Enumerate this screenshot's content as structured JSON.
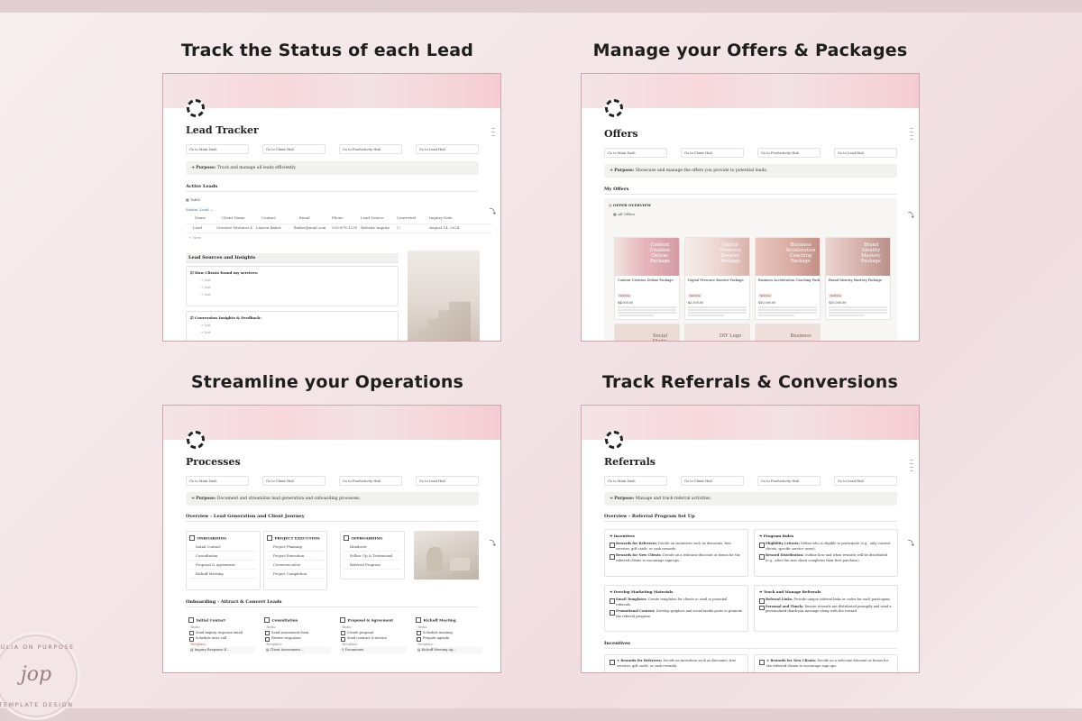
{
  "panels": {
    "p1": {
      "heading": "Track the Status of each Lead"
    },
    "p2": {
      "heading": "Manage your Offers & Packages"
    },
    "p3": {
      "heading": "Streamline your Operations"
    },
    "p4": {
      "heading": "Track Referrals & Conversions"
    }
  },
  "nav": {
    "main": "Go to Main Dash",
    "client": "Go to Client Hub",
    "productivity": "Go to Productivity Hub",
    "lead": "Go to Lead Hub"
  },
  "lead": {
    "title": "Lead Tracker",
    "purpose_label": "Purpose:",
    "purpose": "Track and manage all leads efficiently.",
    "active_leads": "Active Leads",
    "view": "Table",
    "filter": "Status: Lead",
    "columns": [
      "Name",
      "Client Name",
      "Contact",
      "Email",
      "Phone",
      "Lead Source",
      "Converted",
      "Inquiry Date"
    ],
    "row": [
      "Lead",
      "Creative Ventures Inc.",
      "Lauren Baker",
      "lbaker@mail.com",
      "555-678-1235",
      "Website Inquiry",
      "",
      "August 14, 2024"
    ],
    "new": "+ New",
    "sources": "Lead Sources and Insights",
    "q1": "How Clients found my services:",
    "q2": "Conversion Insights & Feedback:",
    "bullet": "List"
  },
  "offers": {
    "title": "Offers",
    "purpose_label": "Purpose:",
    "purpose": "Showcase and manage the offers you provide to potential leads.",
    "my_offers": "My Offers",
    "overview": "OFFER OVERVIEW",
    "view": "All Offers",
    "cards": [
      {
        "img": "Content Creation Deluxe Package",
        "name": "Content Creation Deluxe Package",
        "tag": "Service",
        "price": "$4,000.00"
      },
      {
        "img": "Digital Presence Booster Package",
        "name": "Digital Presence Booster Package",
        "tag": "Service",
        "price": "$3,500.00"
      },
      {
        "img": "Business Acceleration Coaching Package",
        "name": "Business Acceleration Coaching Package",
        "tag": "Service",
        "price": "$10,000.00"
      },
      {
        "img": "Brand Identity Mastery Package",
        "name": "Brand Identity Mastery Package",
        "tag": "Service",
        "price": "$10,000.00"
      }
    ],
    "cards2": [
      "Social Media",
      "DIY Logo",
      "Business"
    ]
  },
  "processes": {
    "title": "Processes",
    "purpose_label": "Purpose:",
    "purpose": "Document and streamline lead generation and onboarding processes.",
    "overview": "Overview - Lead Generation and Client Journey",
    "cols": [
      {
        "head": "ONBOARDING",
        "items": [
          "Initial Contact",
          "Consultation",
          "Proposal & Agreement",
          "Kickoff Meeting"
        ]
      },
      {
        "head": "PROJECT EXECUTION",
        "items": [
          "Project Planning",
          "Project Execution",
          "Communication",
          "Project Completion"
        ]
      },
      {
        "head": "OFFBOARDING",
        "items": [
          "Handover",
          "Follow Up & Testimonial",
          "Referral Program"
        ]
      }
    ],
    "onboarding": "Onboarding - Attract & Convert Leads",
    "tasks_label": "Tasks:",
    "template_label": "Template:",
    "steps": [
      {
        "head": "Initial Contact",
        "tasks": [
          "Send inquiry response email",
          "Schedule intro call"
        ],
        "template": "Inquiry Response E..."
      },
      {
        "head": "Consultation",
        "tasks": [
          "Send assessment form",
          "Review responses"
        ],
        "template": "Client Assessment ..."
      },
      {
        "head": "Proposal & Agreement",
        "tasks": [
          "Create proposal",
          "Send contract & invoice"
        ],
        "template": "Documents"
      },
      {
        "head": "Kickoff Meeting",
        "tasks": [
          "Schedule meeting",
          "Prepare agenda"
        ],
        "template": "Kickoff Meeting Ag..."
      }
    ]
  },
  "referrals": {
    "title": "Referrals",
    "purpose_label": "Purpose:",
    "purpose": "Manage and track referral activities.",
    "overview": "Overview - Referral Program Set Up",
    "boxes": [
      {
        "head": "Incentives",
        "items": [
          {
            "b": "Rewards for Referrers:",
            "t": "Decide on incentives such as discounts, free services, gift cards, or cash rewards."
          },
          {
            "b": "Rewards for New Clients:",
            "t": "Decide on a welcome discount or bonus for the referred clients to encourage sign-ups."
          }
        ]
      },
      {
        "head": "Program Rules",
        "items": [
          {
            "b": "Eligibility Criteria:",
            "t": "Define who is eligible to participate (e.g., only current clients, specific service users)."
          },
          {
            "b": "Reward Distribution:",
            "t": "Outline how and when rewards will be distributed (e.g., after the new client completes their first purchase)."
          }
        ]
      },
      {
        "head": "Develop Marketing Materials",
        "items": [
          {
            "b": "Email Templates:",
            "t": "Create templates for clients to send to potential referrals."
          },
          {
            "b": "Promotional Content:",
            "t": "Develop graphics and social media posts to promote the referral program."
          }
        ]
      },
      {
        "head": "Track and Manage Referrals",
        "items": [
          {
            "b": "Referral Links:",
            "t": "Provide unique referral links or codes for each participant."
          },
          {
            "b": "Personal and Timely:",
            "t": "Ensure rewards are distributed promptly and send a personalized thank-you message along with the reward."
          }
        ]
      }
    ],
    "incentives": "Incentives",
    "inc1_b": "Rewards for Referrers:",
    "inc1": "Decide on incentives such as discounts, free services, gift cards, or cash rewards.",
    "inc2_b": "Rewards for New Clients:",
    "inc2": "Decide on a welcome discount or bonus for the referred clients to encourage sign-ups."
  },
  "logo": {
    "top": "JULIA ON PURPOSE",
    "mono": "jop",
    "bottom": "TEMPLATE DESIGN"
  }
}
